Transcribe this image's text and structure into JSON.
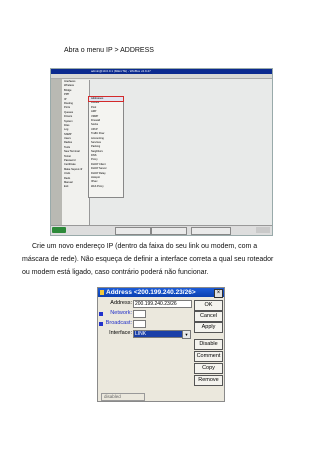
{
  "doc": {
    "p1": "Abra o menu IP > ADDRESS",
    "p2_line1": "Crie um novo endereço IP (dentro da faixa do seu link ou modem, com a",
    "p2_line2": "máscara de rede). Não esqueça de definir a interface correta a qual seu roteador",
    "p2_line3": "ou modem está ligado, caso contrário poderá não funcionar."
  },
  "winbox": {
    "title": "admin@10.0.0.1 (MikroTik) - WinBox v2.9.27",
    "left_menu": [
      "Interfaces",
      "Wireless",
      "Bridge",
      "PPP",
      "IP",
      "Routing",
      "Ports",
      "Queues",
      "Drivers",
      "System",
      "Files",
      "Log",
      "SNMP",
      "Users",
      "Radius",
      "Tools",
      "New Terminal",
      "Telnet",
      "Password",
      "Certificate",
      "Make Supout.rif",
      "Undo",
      "Redo",
      "Manual",
      "Exit"
    ],
    "ip_submenu": [
      "Addresses",
      "Routes",
      "Pool",
      "ARP",
      "VRRP",
      "Firewall",
      "Socks",
      "UPnP",
      "Traffic Flow",
      "Accounting",
      "Services",
      "Packing",
      "Neighbors",
      "DNS",
      "Proxy",
      "DHCP Client",
      "DHCP Server",
      "DHCP Relay",
      "Hotspot",
      "IPsec",
      "Web Proxy"
    ],
    "selected_item": "Addresses"
  },
  "dialog": {
    "title": "Address <200.199.240.23/26>",
    "close_glyph": "×",
    "address_label": "Address:",
    "address_value": "200.199.240.23/26",
    "network_label": "Network:",
    "network_value": "",
    "broadcast_label": "Broadcast:",
    "broadcast_value": "",
    "interface_label": "Interface:",
    "interface_value": "LINK",
    "buttons": [
      "OK",
      "Cancel",
      "Apply",
      "Disable",
      "Comment",
      "Copy",
      "Remove"
    ],
    "status": "disabled"
  }
}
